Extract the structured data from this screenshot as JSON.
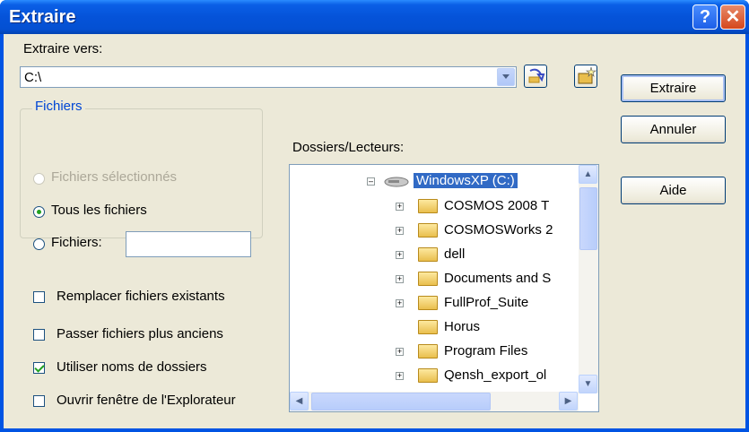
{
  "window": {
    "title": "Extraire",
    "help_glyph": "?",
    "close_glyph": "✕"
  },
  "extract_to": {
    "label": "Extraire vers:",
    "value": "C:\\"
  },
  "files_group": {
    "title": "Fichiers",
    "selected_label": "Fichiers sélectionnés",
    "all_label": "Tous les fichiers",
    "files_label": "Fichiers:",
    "files_value": ""
  },
  "options": {
    "replace_label": "Remplacer fichiers existants",
    "skip_older_label": "Passer fichiers plus anciens",
    "use_folders_label": "Utiliser noms de dossiers",
    "open_explorer_label": "Ouvrir fenêtre de l'Explorateur"
  },
  "folders": {
    "label": "Dossiers/Lecteurs:",
    "drive": "WindowsXP (C:)",
    "items": [
      "COSMOS 2008 T",
      "COSMOSWorks 2",
      "dell",
      "Documents and S",
      "FullProf_Suite",
      "Horus",
      "Program Files",
      "Qensh_export_ol"
    ]
  },
  "buttons": {
    "extract": "Extraire",
    "cancel": "Annuler",
    "help": "Aide"
  },
  "colors": {
    "titlebar": "#0054e3",
    "face": "#ece9d8",
    "selection": "#316ac5",
    "group_title": "#0046d5"
  }
}
